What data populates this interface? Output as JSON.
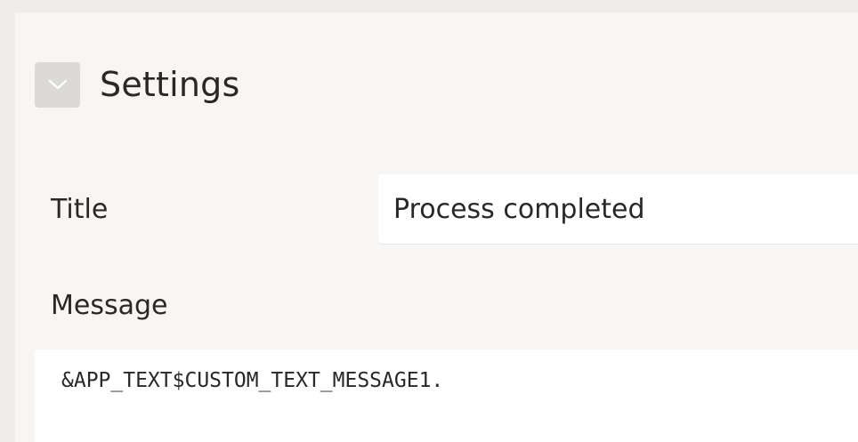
{
  "settings": {
    "section_title": "Settings",
    "toggle_icon": "chevron-down-icon",
    "title_field": {
      "label": "Title",
      "value": "Process completed"
    },
    "message_field": {
      "label": "Message",
      "value": "&APP_TEXT$CUSTOM_TEXT_MESSAGE1."
    }
  }
}
